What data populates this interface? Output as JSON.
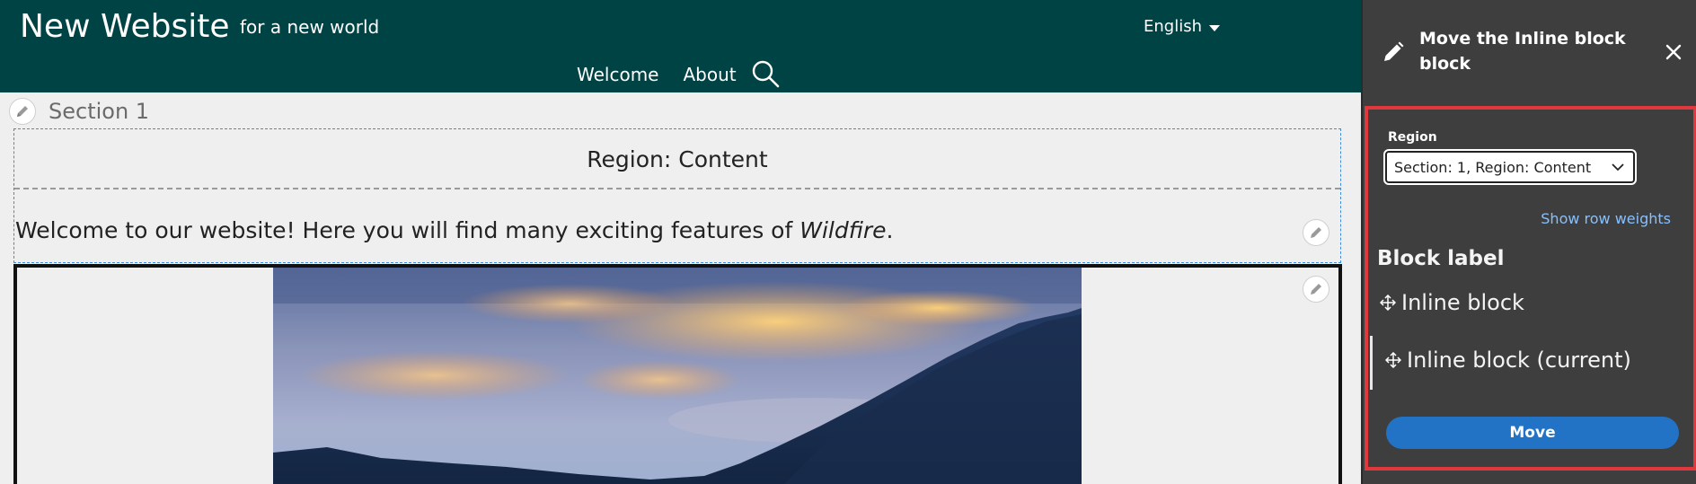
{
  "site": {
    "name": "New Website",
    "slogan": "for a new world",
    "language": "English",
    "nav": [
      "Welcome",
      "About"
    ]
  },
  "layout_builder": {
    "section_label": "Section 1",
    "region_label": "Region: Content",
    "welcome_prefix": "Welcome to our website! Here you will find many exciting features of ",
    "welcome_emphasis": "Wildfire",
    "welcome_suffix": "."
  },
  "dialog": {
    "title": "Move the Inline block block",
    "region_field_label": "Region",
    "region_selected": "Section: 1, Region: Content",
    "show_row_weights": "Show row weights",
    "table_header": "Block label",
    "blocks": [
      "Inline block",
      "Inline block (current)"
    ],
    "move_button": "Move"
  },
  "colors": {
    "header_bg": "#004345",
    "dialog_bg": "#3e3e3e",
    "highlight_border": "#e0383c",
    "primary_button": "#2273c5",
    "link": "#86c0ff",
    "region_outline": "#3a8edb"
  },
  "icons": [
    "search-icon",
    "pencil-icon",
    "close-icon",
    "chevron-down-icon",
    "drag-handle-icon",
    "caret-down-icon"
  ]
}
